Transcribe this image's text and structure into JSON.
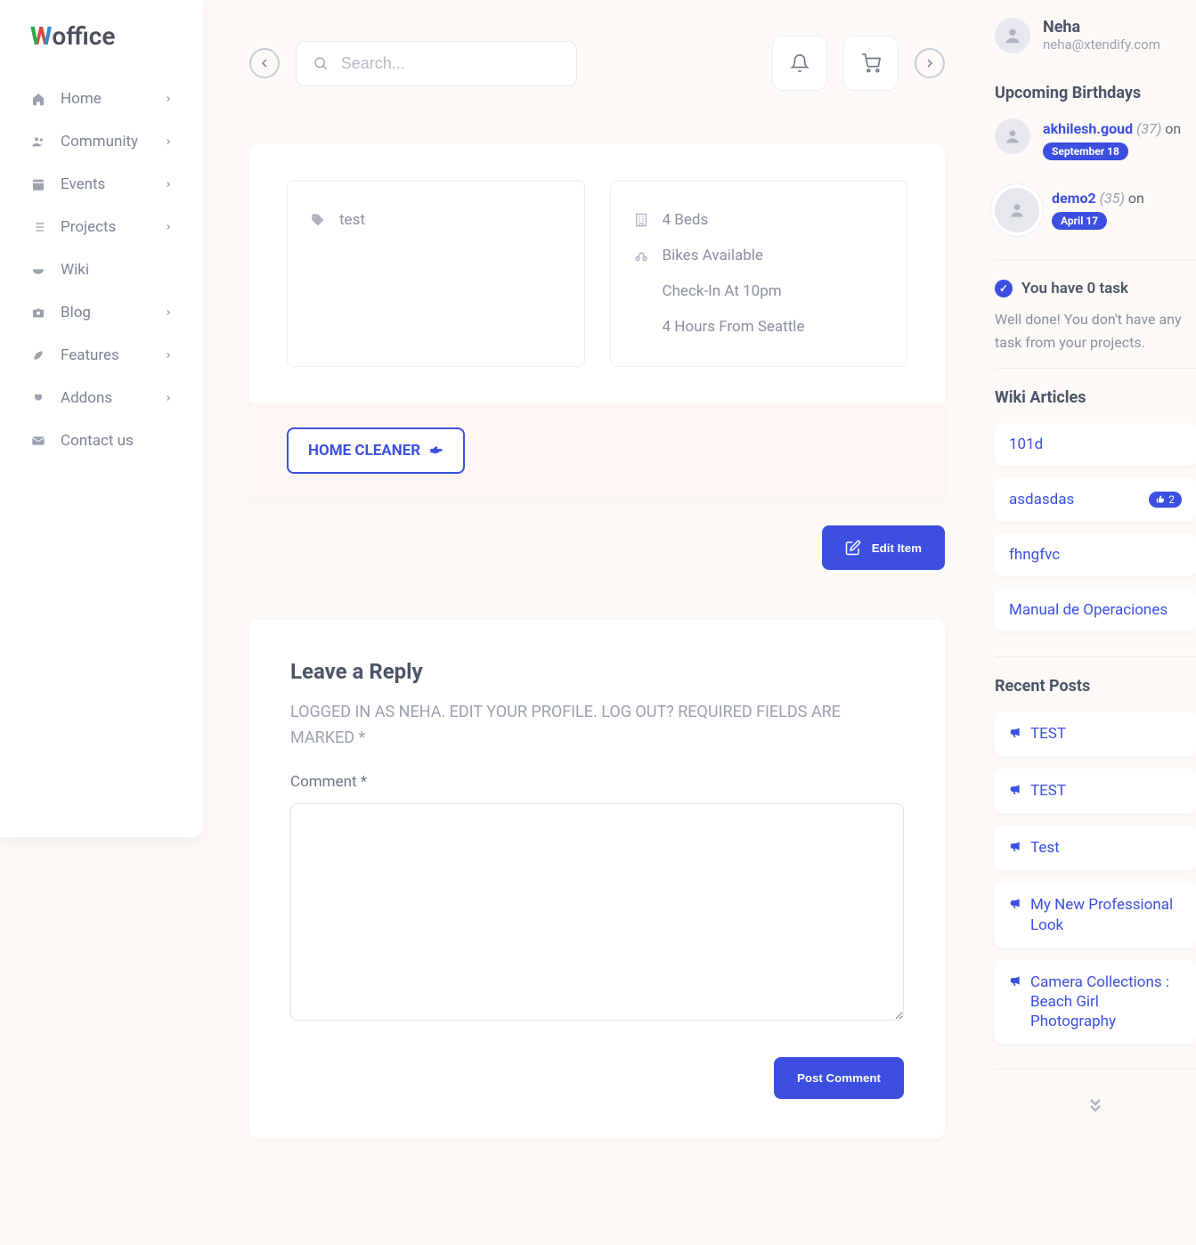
{
  "brand": {
    "suffix": "office"
  },
  "nav": [
    {
      "label": "Home",
      "icon": "home",
      "chev": true
    },
    {
      "label": "Community",
      "icon": "users",
      "chev": true
    },
    {
      "label": "Events",
      "icon": "calendar",
      "chev": true
    },
    {
      "label": "Projects",
      "icon": "list",
      "chev": true
    },
    {
      "label": "Wiki",
      "icon": "bowl",
      "chev": false
    },
    {
      "label": "Blog",
      "icon": "camera",
      "chev": true
    },
    {
      "label": "Features",
      "icon": "leaf",
      "chev": true
    },
    {
      "label": "Addons",
      "icon": "plug",
      "chev": true
    },
    {
      "label": "Contact us",
      "icon": "mail",
      "chev": false
    }
  ],
  "search": {
    "placeholder": "Search..."
  },
  "item": {
    "tags": [
      "test"
    ],
    "features": [
      "4 Beds",
      "Bikes Available",
      "Check-In At 10pm",
      "4 Hours From Seattle"
    ],
    "cta": "HOME CLEANER",
    "edit": "Edit Item"
  },
  "reply": {
    "heading": "Leave a Reply",
    "logged_prefix": "LOGGED IN AS ",
    "logged_name": "NEHA",
    "edit_profile": "EDIT YOUR PROFILE.",
    "logout": "LOG OUT?",
    "required": "REQUIRED FIELDS ARE MARKED *",
    "comment_label": "Comment *",
    "submit": "Post Comment"
  },
  "user": {
    "name": "Neha",
    "email": "neha@xtendify.com"
  },
  "birthdays": {
    "title": "Upcoming Birthdays",
    "items": [
      {
        "name": "akhilesh.goud",
        "age": "(37)",
        "on": "on",
        "date": "September 18"
      },
      {
        "name": "demo2",
        "age": "(35)",
        "on": "on",
        "date": "April 17"
      }
    ]
  },
  "tasks": {
    "headline": "You have 0 task",
    "body": "Well done! You don't have any task from your projects."
  },
  "wiki": {
    "title": "Wiki Articles",
    "items": [
      {
        "label": "101d"
      },
      {
        "label": "asdasdas",
        "likes": "2"
      },
      {
        "label": "fhngfvc"
      },
      {
        "label": "Manual de Operaciones"
      }
    ]
  },
  "posts": {
    "title": "Recent Posts",
    "items": [
      {
        "label": "TEST"
      },
      {
        "label": "TEST"
      },
      {
        "label": "Test"
      },
      {
        "label": "My New Professional Look"
      },
      {
        "label": "Camera Collections : Beach Girl Photography"
      }
    ]
  }
}
